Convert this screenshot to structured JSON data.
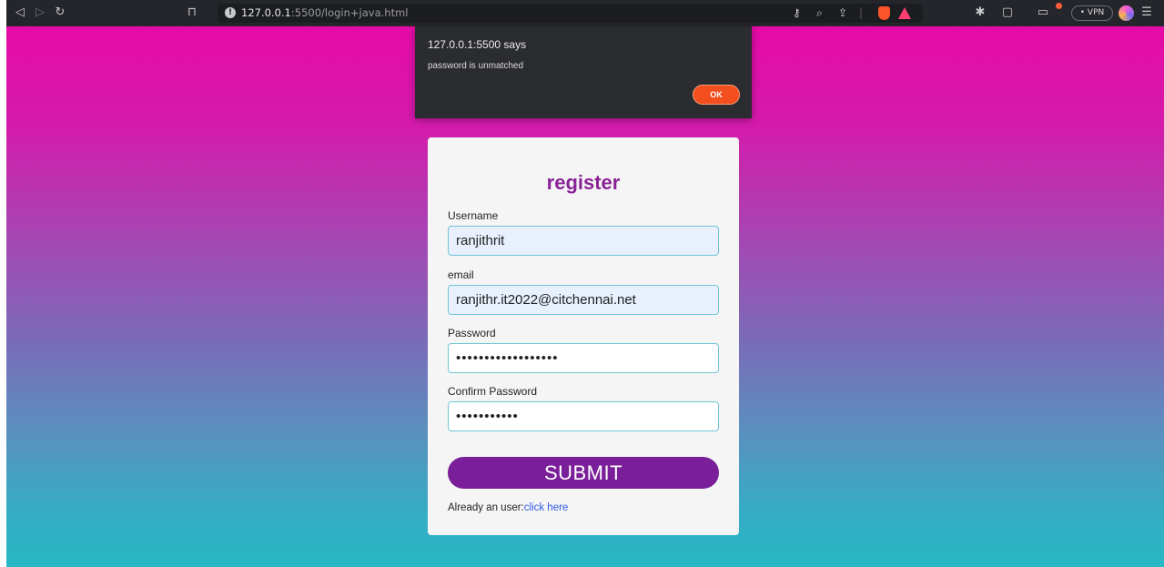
{
  "browser": {
    "url_host": "127.0.0.1",
    "url_rest": ":5500/login+java.html",
    "vpn_label": "• VPN"
  },
  "alert": {
    "title": "127.0.0.1:5500 says",
    "message": "password is unmatched",
    "ok_label": "OK"
  },
  "form": {
    "title": "register",
    "username_label": "Username",
    "username_value": "ranjithrit",
    "email_label": "email",
    "email_value": "ranjithr.it2022@citchennai.net",
    "password_label": "Password",
    "password_value": "••••••••••••••••••",
    "confirm_label": "Confirm Password",
    "confirm_value": "•••••••••••",
    "submit_label": "SUBMIT",
    "already_text": "Already an user:",
    "link_text": "click here"
  },
  "colors": {
    "accent_purple": "#7a1f99",
    "title_purple": "#8a2297",
    "alert_ok": "#f24e1e",
    "link_blue": "#2f59e6"
  }
}
